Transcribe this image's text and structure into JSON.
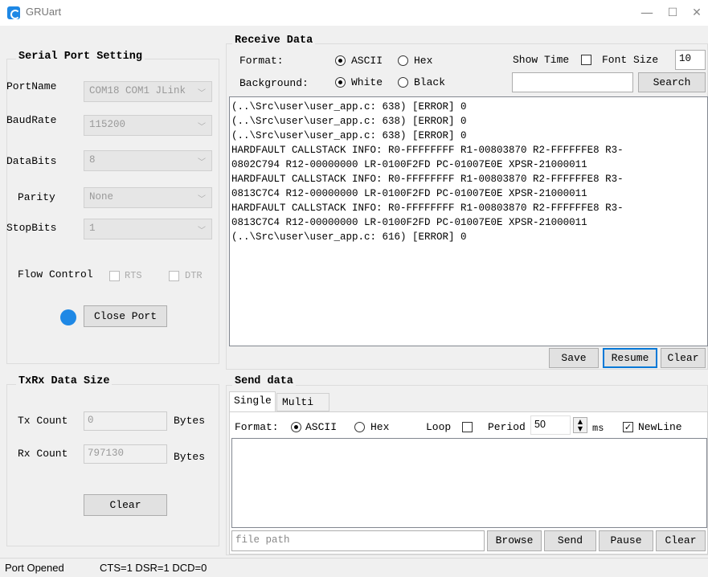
{
  "window": {
    "title": "GRUart",
    "minimize": "—",
    "maximize": "☐",
    "close": "✕"
  },
  "serial": {
    "title": "Serial Port Setting",
    "port_name": {
      "label": "PortName",
      "value": "COM18 COM1 JLink"
    },
    "baud_rate": {
      "label": "BaudRate",
      "value": "115200"
    },
    "data_bits": {
      "label": "DataBits",
      "value": "8"
    },
    "parity": {
      "label": "Parity",
      "value": "None"
    },
    "stop_bits": {
      "label": "StopBits",
      "value": "1"
    },
    "flow_control": {
      "label": "Flow Control",
      "rts": "RTS",
      "dtr": "DTR"
    },
    "close_port": "Close Port",
    "status_color": "#1e88e5"
  },
  "txrx": {
    "title": "TxRx Data Size",
    "tx_label": "Tx Count",
    "tx_value": "0",
    "tx_unit": "Bytes",
    "rx_label": "Rx Count",
    "rx_value": "797130",
    "rx_unit": "Bytes",
    "clear": "Clear"
  },
  "receive": {
    "title": "Receive Data",
    "format_label": "Format:",
    "ascii": "ASCII",
    "hex": "Hex",
    "background_label": "Background:",
    "white": "White",
    "black": "Black",
    "show_time": "Show Time",
    "font_size_label": "Font Size",
    "font_size_value": "10",
    "search_value": "",
    "search": "Search",
    "lines": [
      "(..\\Src\\user\\user_app.c: 638) [ERROR] 0",
      "(..\\Src\\user\\user_app.c: 638) [ERROR] 0",
      "(..\\Src\\user\\user_app.c: 638) [ERROR] 0",
      "HARDFAULT CALLSTACK INFO: R0-FFFFFFFF R1-00803870 R2-FFFFFFE8 R3-",
      "0802C794 R12-00000000 LR-0100F2FD PC-01007E0E XPSR-21000011",
      "HARDFAULT CALLSTACK INFO: R0-FFFFFFFF R1-00803870 R2-FFFFFFE8 R3-",
      "0813C7C4 R12-00000000 LR-0100F2FD PC-01007E0E XPSR-21000011",
      "HARDFAULT CALLSTACK INFO: R0-FFFFFFFF R1-00803870 R2-FFFFFFE8 R3-",
      "0813C7C4 R12-00000000 LR-0100F2FD PC-01007E0E XPSR-21000011",
      "(..\\Src\\user\\user_app.c: 616) [ERROR] 0"
    ],
    "save": "Save",
    "resume": "Resume",
    "clear": "Clear"
  },
  "send": {
    "title": "Send data",
    "tab_single": "Single",
    "tab_multi": "Multi",
    "format_label": "Format:",
    "ascii": "ASCII",
    "hex": "Hex",
    "loop": "Loop",
    "period_label": "Period",
    "period_value": "50",
    "ms": "ms",
    "newline": "NewLine",
    "file_path_placeholder": "file path",
    "browse": "Browse",
    "send": "Send",
    "pause": "Pause",
    "clear": "Clear"
  },
  "status_bar": {
    "port_status": "Port Opened",
    "signals": "CTS=1 DSR=1 DCD=0"
  }
}
